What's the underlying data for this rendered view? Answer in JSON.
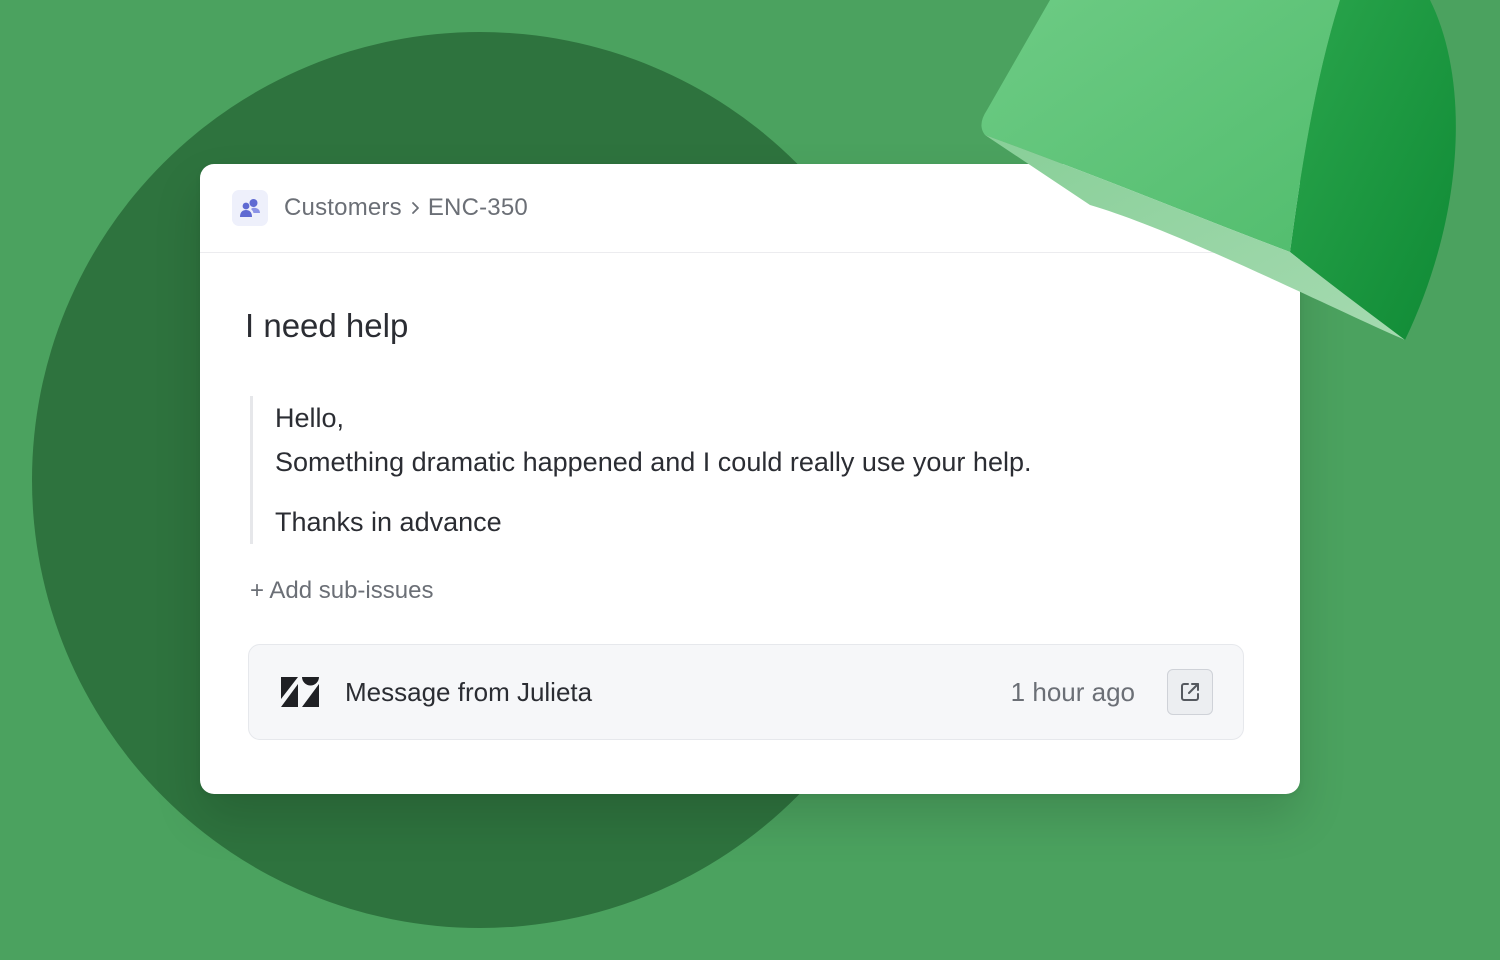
{
  "breadcrumb": {
    "team": "Customers",
    "issue_id": "ENC-350"
  },
  "issue": {
    "title": "I need help",
    "quote": {
      "greeting": "Hello,",
      "body": "Something dramatic happened and I could really use your help.",
      "signoff": "Thanks in advance"
    },
    "add_sub_issues_label": "+ Add sub-issues"
  },
  "attachment": {
    "source_icon": "zendesk-icon",
    "title": "Message from Julieta",
    "time": "1 hour ago",
    "action_icon": "external-link-icon"
  },
  "colors": {
    "background": "#4ba25f",
    "circle": "#2e733e",
    "card": "#ffffff",
    "team_icon": "#5f6ad2",
    "text_primary": "#2b2d33",
    "text_secondary": "#6b6f76"
  }
}
